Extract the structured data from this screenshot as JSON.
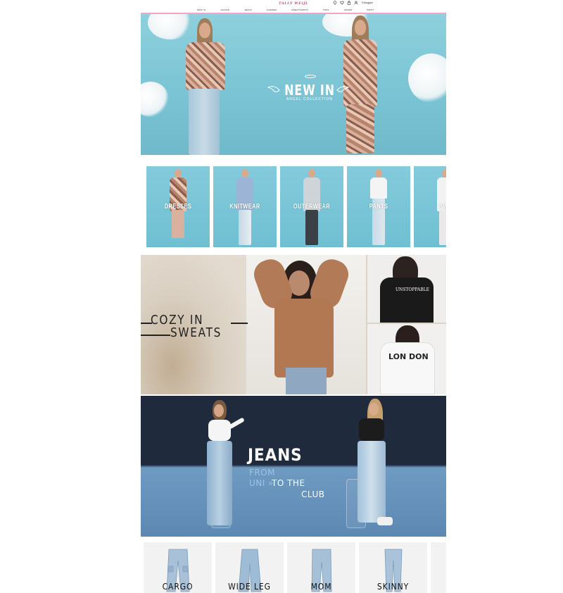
{
  "header": {
    "logo": "TALLY WEiJL",
    "login_label": "Einloggen",
    "icons": [
      "location-icon",
      "heart-icon",
      "bag-icon"
    ],
    "nav": [
      "NEW IN",
      "JACKEN",
      "JEANS",
      "KLEIDER",
      "SWEATSHIRTS",
      "TOPS",
      "HOSEN",
      "PARTY"
    ],
    "accent_color": "#f4a4c6"
  },
  "hero": {
    "title": "NEW IN",
    "subtitle": "ANGEL COLLECTION",
    "background": "#8ed0dd"
  },
  "categories": {
    "items": [
      {
        "label": "DRESSES"
      },
      {
        "label": "KNITWEAR"
      },
      {
        "label": "OUTERWEAR"
      },
      {
        "label": "PANTS"
      },
      {
        "label": "SWE"
      }
    ]
  },
  "cozy": {
    "line1": "COZY IN",
    "line2": "SWEATS"
  },
  "jeans_banner": {
    "title": "JEANS",
    "from": "FROM",
    "uni": "UNI »",
    "to_the": "TO THE",
    "club": "CLUB"
  },
  "fits": {
    "items": [
      {
        "label": "CARGO"
      },
      {
        "label": "WIDE LEG"
      },
      {
        "label": "MOM"
      },
      {
        "label": "SKINNY"
      }
    ]
  }
}
